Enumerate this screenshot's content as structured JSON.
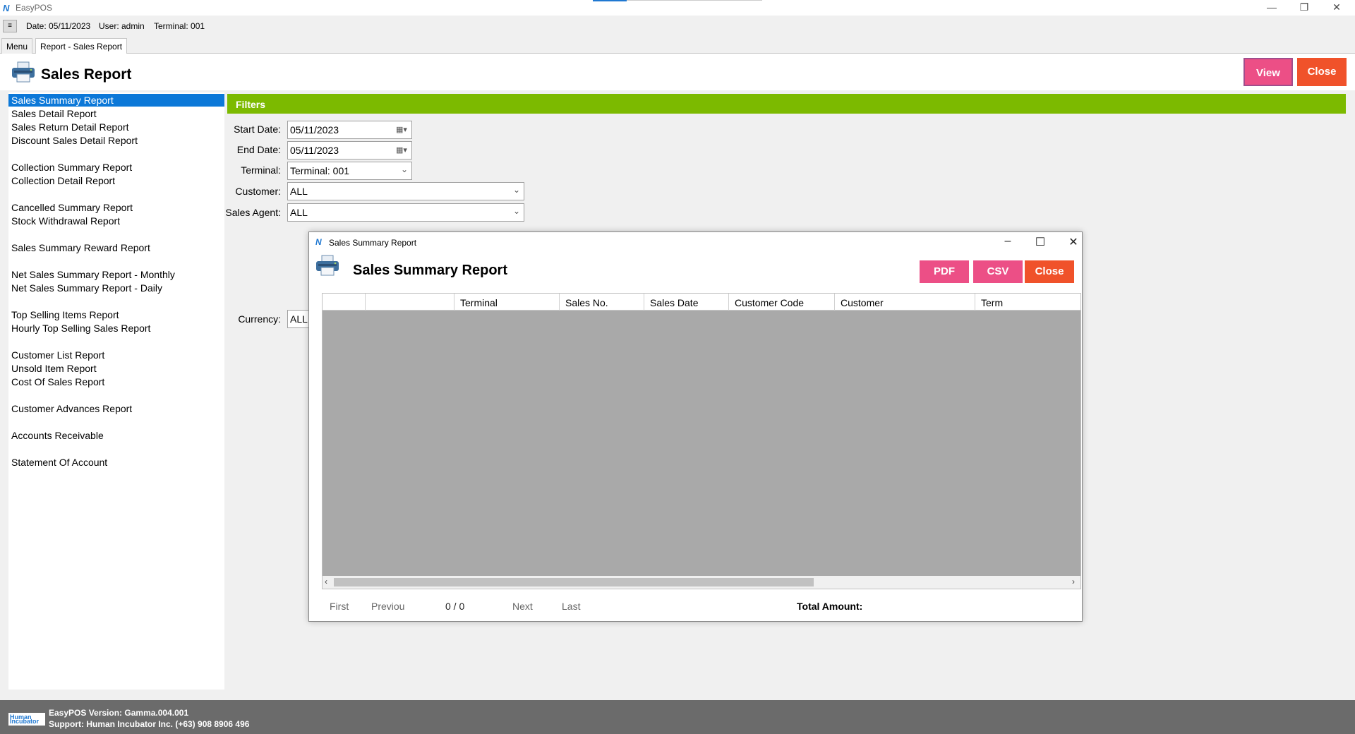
{
  "window": {
    "title": "EasyPOS",
    "controls": [
      "—",
      "❐",
      "✕"
    ]
  },
  "infobar": {
    "menu_glyph": "≡",
    "date": "Date: 05/11/2023",
    "user": "User: admin",
    "terminal": "Terminal: 001"
  },
  "tabs": [
    {
      "label": "Menu"
    },
    {
      "label": "Report - Sales Report"
    }
  ],
  "header": {
    "title": "Sales Report",
    "view_label": "View",
    "close_label": "Close",
    "icon": "printer-icon"
  },
  "sidebar": {
    "items": [
      "Sales Summary Report",
      "Sales Detail Report",
      "Sales Return Detail Report",
      "Discount Sales Detail Report",
      "Collection Summary Report",
      "Collection Detail Report",
      "Cancelled Summary Report",
      "Stock Withdrawal Report",
      "Sales Summary Reward Report",
      "Net Sales Summary Report - Monthly",
      "Net Sales Summary Report - Daily",
      "Top Selling Items Report",
      "Hourly Top Selling Sales Report",
      "Customer List Report",
      "Unsold Item Report",
      "Cost Of Sales Report",
      "Customer Advances Report",
      "Accounts Receivable",
      "Statement Of Account"
    ],
    "selected": "Sales Summary Report"
  },
  "filters": {
    "title": "Filters",
    "start_date_label": "Start Date:",
    "start_date": "05/11/2023",
    "end_date_label": "End Date:",
    "end_date": "05/11/2023",
    "terminal_label": "Terminal:",
    "terminal": "Terminal: 001",
    "customer_label": "Customer:",
    "customer": "ALL",
    "sales_agent_label": "Sales Agent:",
    "sales_agent": "ALL",
    "currency_label": "Currency:",
    "currency": "ALL"
  },
  "modal": {
    "window_title": "Sales Summary Report",
    "title": "Sales Summary Report",
    "pdf_label": "PDF",
    "csv_label": "CSV",
    "close_label": "Close",
    "columns": [
      "",
      "",
      "Terminal",
      "Sales No.",
      "Sales Date",
      "Customer Code",
      "Customer",
      "Term"
    ],
    "pager": {
      "first": "First",
      "previous": "Previou",
      "position": "0 / 0",
      "next": "Next",
      "last": "Last"
    },
    "total_label": "Total Amount:"
  },
  "footer": {
    "version": "EasyPOS Version: Gamma.004.001",
    "support": "Support: Human Incubator Inc. (+63) 908 8906 496",
    "logo_line1": "Human",
    "logo_line2": "Incubator"
  },
  "colors": {
    "accent_green": "#7cba00",
    "button_pink": "#ec4f86",
    "button_orange": "#f0522a",
    "selection_blue": "#0c78d8",
    "footer_gray": "#6b6b6b"
  }
}
